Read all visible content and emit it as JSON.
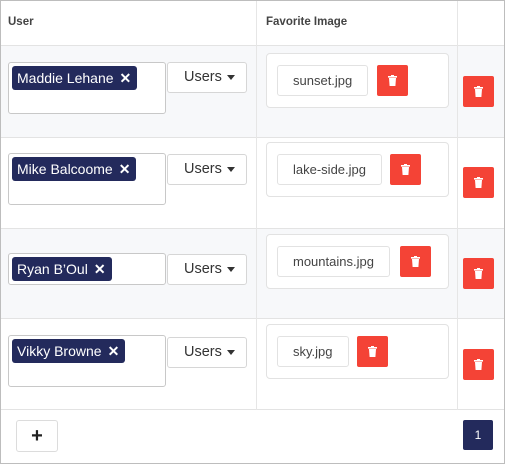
{
  "columns": {
    "user": "User",
    "image": "Favorite Image"
  },
  "users_dropdown_label": "Users",
  "rows": [
    {
      "user": "Maddie Lehane",
      "image": "sunset.jpg"
    },
    {
      "user": "Mike Balcoome",
      "image": "lake-side.jpg"
    },
    {
      "user": "Ryan B’Oul",
      "image": "mountains.jpg"
    },
    {
      "user": "Vikky Browne",
      "image": "sky.jpg"
    }
  ],
  "footer": {
    "add_label": "+",
    "page": "1"
  },
  "icons": {
    "remove_tag": "close-icon",
    "delete": "trash-icon"
  },
  "colors": {
    "tag_bg": "#232a5c",
    "danger": "#f44336",
    "page_active": "#232a5c"
  }
}
